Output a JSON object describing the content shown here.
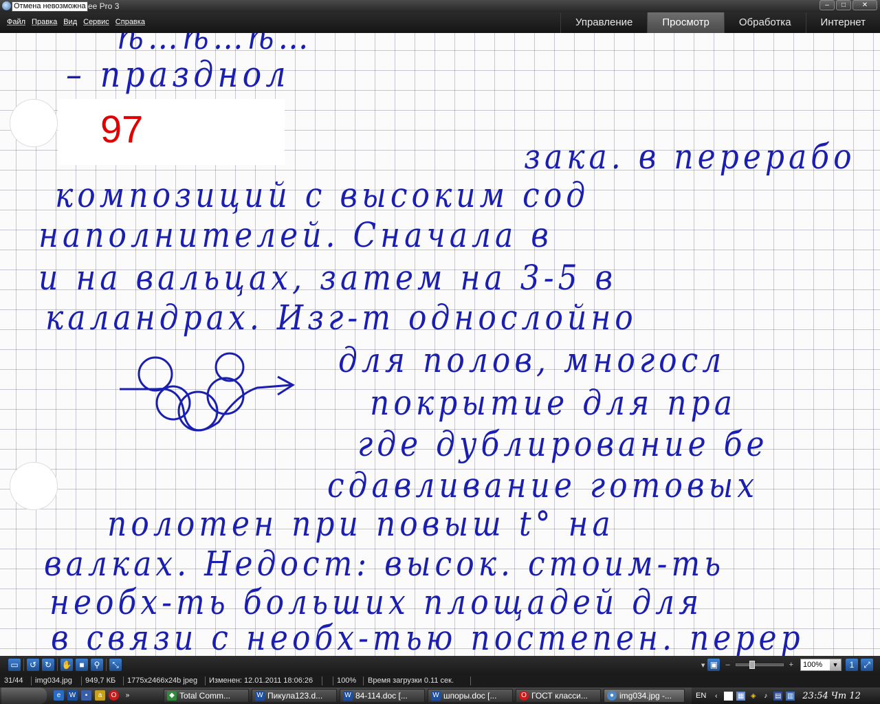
{
  "window": {
    "title_suffix": "ee Pro 3",
    "tooltip": "Отмена невозможна",
    "controls": {
      "minimize": "–",
      "maximize": "□",
      "close": "✕"
    }
  },
  "menu": {
    "items": [
      "Файл",
      "Правка",
      "Вид",
      "Сервис",
      "Справка"
    ]
  },
  "modes": {
    "items": [
      "Управление",
      "Просмотр",
      "Обработка",
      "Интернет"
    ],
    "active": "Просмотр"
  },
  "image": {
    "page_number": "97",
    "handwritten_lines": [
      "ѣ…ѣ…ѣ…",
      "–  празднол",
      "зака. в перерабо",
      "композиций с высоким сод",
      "наполнителей. Сначала в",
      "и на вальцах, затем на 3-5 в",
      "каландрах. Изг-т однослойно",
      "для полов, многосл",
      "покрытие для пра",
      "где дублирование бе",
      "сдавливание готовых",
      "полотен при повыш t° на",
      "валках. Недост: высок. стоим-ть",
      "необх-ть больших площадей для",
      "в связи с необх-тью постепен. перер"
    ]
  },
  "toolbar": {
    "zoom_minus": "–",
    "zoom_plus": "+",
    "zoom_value": "100%",
    "zoom_level": 0.35,
    "icons": [
      "slideshow-icon",
      "rotate-left-icon",
      "rotate-right-icon",
      "hand-tool-icon",
      "select-tool-icon",
      "zoom-tool-icon",
      "fullscreen-icon"
    ]
  },
  "status": {
    "index": "31/44",
    "filename": "img034.jpg",
    "filesize": "949,7 КБ",
    "dimensions": "1775x2466x24b jpeg",
    "modified": "Изменен: 12.01.2011 18:06:26",
    "zoom": "100%",
    "load_time": "Время загрузки 0.11 сек."
  },
  "taskbar": {
    "tasks": [
      "Total Comm...",
      "Пикула123.d...",
      "84-114.doc [...",
      "шпоры.doc [...",
      "ГОСТ класси...",
      "img034.jpg -..."
    ],
    "active_task": 5,
    "language": "EN",
    "clock": "23:54 Чт 12"
  }
}
